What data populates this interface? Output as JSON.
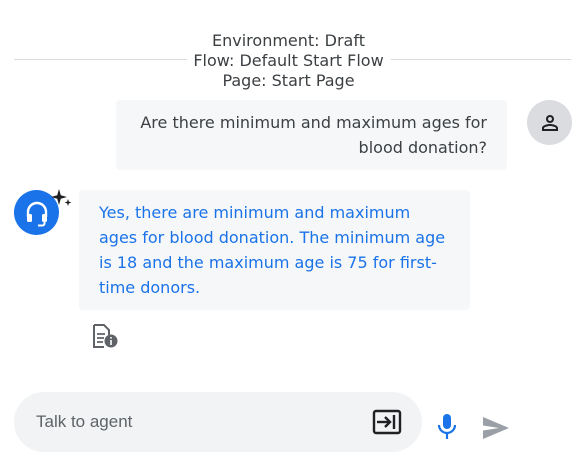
{
  "header": {
    "environment": "Environment: Draft",
    "flow": "Flow: Default Start Flow",
    "page": "Page: Start Page"
  },
  "messages": {
    "user": "Are there minimum and maximum ages for blood donation?",
    "agent": "Yes, there are minimum and maximum ages for blood donation. The minimum age is 18 and the maximum age is 75 for first-time donors."
  },
  "composer": {
    "placeholder": "Talk to agent"
  },
  "icons": {
    "user_avatar": "person-icon",
    "agent_avatar": "headset-icon",
    "sparkle": "sparkle-icon",
    "info": "document-info-icon",
    "exit": "exit-icon",
    "mic": "mic-icon",
    "send": "send-icon"
  },
  "colors": {
    "accent": "#1a73e8",
    "bubble": "#f6f7f9",
    "text": "#3c4043"
  }
}
